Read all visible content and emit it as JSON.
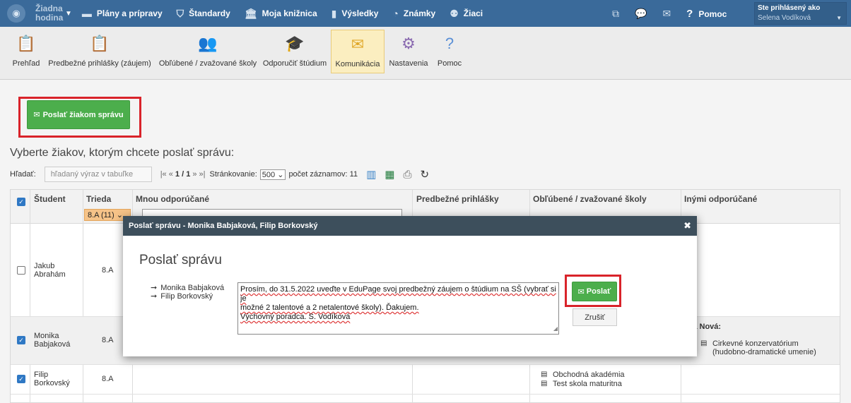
{
  "topbar": {
    "hour_label": "Žiadna hodina",
    "nav": [
      {
        "icon": "calendar-icon",
        "glyph": "▬",
        "label": "Plány a prípravy"
      },
      {
        "icon": "shield-icon",
        "glyph": "⛉",
        "label": "Štandardy"
      },
      {
        "icon": "library-icon",
        "glyph": "🏛",
        "label": "Moja knižnica"
      },
      {
        "icon": "bar-chart-icon",
        "glyph": "▮",
        "label": "Výsledky"
      },
      {
        "icon": "grades-icon",
        "glyph": "◔",
        "label": "Známky"
      },
      {
        "icon": "students-icon",
        "glyph": "⚉",
        "label": "Žiaci"
      }
    ],
    "help_label": "Pomoc",
    "user_line1": "Ste prihlásený ako",
    "user_line2": "Selena Vodíková"
  },
  "toolbar": {
    "items": [
      {
        "label": "Prehľad",
        "icon": "overview-icon"
      },
      {
        "label": "Predbežné prihlášky (záujem)",
        "icon": "applications-icon"
      },
      {
        "label": "Obľúbené / zvažované školy",
        "icon": "favorite-schools-icon"
      },
      {
        "label": "Odporučiť štúdium",
        "icon": "graduation-cap-icon"
      },
      {
        "label": "Komunikácia",
        "icon": "mail-icon"
      },
      {
        "label": "Nastavenia",
        "icon": "settings-icon"
      },
      {
        "label": "Pomoc",
        "icon": "help-icon"
      }
    ],
    "active": "Komunikácia"
  },
  "main": {
    "send_button": "Poslať žiakom správu",
    "heading": "Vyberte žiakov, ktorým chcete poslať správu:",
    "search_label": "Hľadať:",
    "search_placeholder": "hľadaný výraz v tabuľke",
    "pager_prefix": "|« «",
    "pager_current": "1 / 1",
    "pager_suffix": "» »|",
    "paging_label": "Stránkovanie:",
    "page_size": "500",
    "records_label": "počet záznamov: 11"
  },
  "table": {
    "columns": [
      "Študent",
      "Trieda",
      "Mnou odporúčané",
      "Predbežné prihlášky",
      "Obľúbené / zvažované školy",
      "Inými odporúčané"
    ],
    "class_filter": "8.A (11)",
    "rows": [
      {
        "name_first": "Jakub",
        "name_last": "Abrahám",
        "class": "8.A",
        "checked": false,
        "favorites": [],
        "others_label": "",
        "others": []
      },
      {
        "name_first": "Monika",
        "name_last": "Babjaková",
        "class": "8.A",
        "checked": true,
        "favorites": [],
        "others_label": "ria Nová:",
        "others": [
          {
            "line1": "Cirkevné konzervatórium",
            "line2": "(hudobno-dramatické umenie)"
          }
        ]
      },
      {
        "name_first": "Filip",
        "name_last": "Borkovský",
        "class": "8.A",
        "checked": true,
        "favorites": [
          "Obchodná akadémia",
          "Test skola maturitna"
        ],
        "others_label": "",
        "others": []
      }
    ]
  },
  "dialog": {
    "title": "Poslať správu - Monika Babjaková, Filip Borkovský",
    "heading": "Poslať správu",
    "recipients": [
      "Monika Babjaková",
      "Filip Borkovský"
    ],
    "message_line1": "Prosím, do 31.5.2022 uveďte v EduPage svoj predbežný záujem o štúdium na SŠ (vybrať si je",
    "message_line2": "možné 2 talentové a 2 netalentové školy). Ďakujem.",
    "message_line3": "Výchovný poradca. S. Vodíková",
    "send_label": "Poslať",
    "cancel_label": "Zrušiť"
  }
}
